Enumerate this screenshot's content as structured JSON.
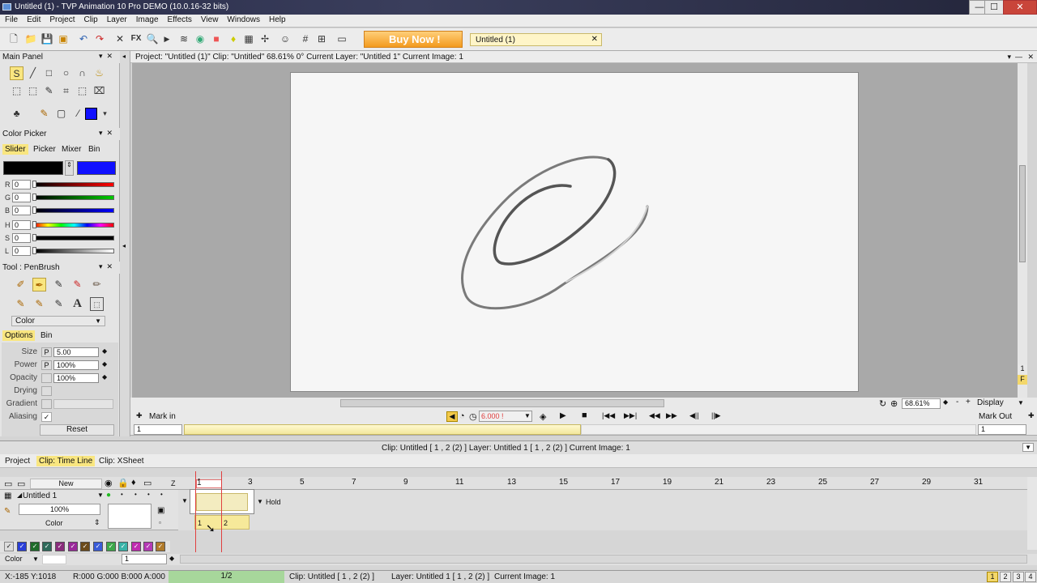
{
  "window": {
    "title": "Untitled (1) - TVP Animation 10 Pro DEMO (10.0.16-32 bits)",
    "min": "—",
    "max": "☐",
    "close": "✕"
  },
  "menu": [
    "File",
    "Edit",
    "Project",
    "Clip",
    "Layer",
    "Image",
    "Effects",
    "View",
    "Windows",
    "Help"
  ],
  "toolbar": {
    "buy_label": "Buy Now !",
    "project_tab": "Untitled (1)",
    "project_tab_close": "✕",
    "fx_label": "FX"
  },
  "main_panel": {
    "title": "Main Panel"
  },
  "color_picker": {
    "title": "Color Picker",
    "tabs": [
      "Slider",
      "Picker",
      "Mixer",
      "Bin"
    ],
    "active_tab": "Slider",
    "primary_color": "#000000",
    "secondary_color": "#1010ff",
    "channels": [
      {
        "label": "R",
        "value": "0"
      },
      {
        "label": "G",
        "value": "0"
      },
      {
        "label": "B",
        "value": "0"
      },
      {
        "label": "H",
        "value": "0"
      },
      {
        "label": "S",
        "value": "0"
      },
      {
        "label": "L",
        "value": "0"
      }
    ]
  },
  "tool": {
    "title": "Tool : PenBrush",
    "mode": "Color",
    "tabs": [
      "Options",
      "Bin"
    ],
    "options": [
      {
        "label": "Size",
        "p": "P",
        "value": "5.00"
      },
      {
        "label": "Power",
        "p": "P",
        "value": "100%"
      },
      {
        "label": "Opacity",
        "p": "",
        "value": "100%"
      },
      {
        "label": "Drying",
        "p": "",
        "value": ""
      },
      {
        "label": "Gradient",
        "p": "",
        "value": ""
      },
      {
        "label": "Aliasing",
        "p": "",
        "value": "✓"
      }
    ],
    "reset_label": "Reset"
  },
  "view": {
    "header": "Project: \"Untitled (1)\"  Clip: \"Untitled\"  68.61%  0°  Current Layer: \"Untitled 1\"  Current Image: 1",
    "zoom": "68.61%",
    "display": "Display",
    "zoom_minus": "-",
    "zoom_plus": "+",
    "side_labels": [
      "1",
      "F"
    ]
  },
  "player": {
    "mark_in": "Mark in",
    "mark_out": "Mark Out",
    "fps": "6.000 !",
    "in_value": "1",
    "out_value": "1"
  },
  "timeline": {
    "info": "Clip: Untitled [ 1 , 2  (2) ]      Layer: Untitled 1 [ 1 , 2  (2) ]      Current Image: 1",
    "tabs": [
      "Project",
      "Clip: Time Line",
      "Clip: XSheet"
    ],
    "active_tab": "Clip: Time Line",
    "new_label": "New",
    "z_label": "Z",
    "ruler": [
      "1",
      "3",
      "5",
      "7",
      "9",
      "11",
      "13",
      "15",
      "17",
      "19",
      "21",
      "23",
      "25",
      "27",
      "29",
      "31"
    ],
    "layer": {
      "name": "Untitled 1",
      "opacity": "100%",
      "mode": "Color"
    },
    "hold_label": "Hold",
    "frames": [
      "1",
      "2"
    ],
    "color_mode": "Color",
    "frame_field": "1"
  },
  "status": {
    "coords": "X:-185  Y:1018",
    "rgba": "R:000 G:000 B:000 A:000",
    "frame": "1/2",
    "clip": "Clip: Untitled [ 1 , 2  (2) ]",
    "layer": "Layer: Untitled 1 [ 1 , 2  (2) ]",
    "image": "Current Image: 1",
    "pages": [
      "1",
      "2",
      "3",
      "4"
    ]
  }
}
